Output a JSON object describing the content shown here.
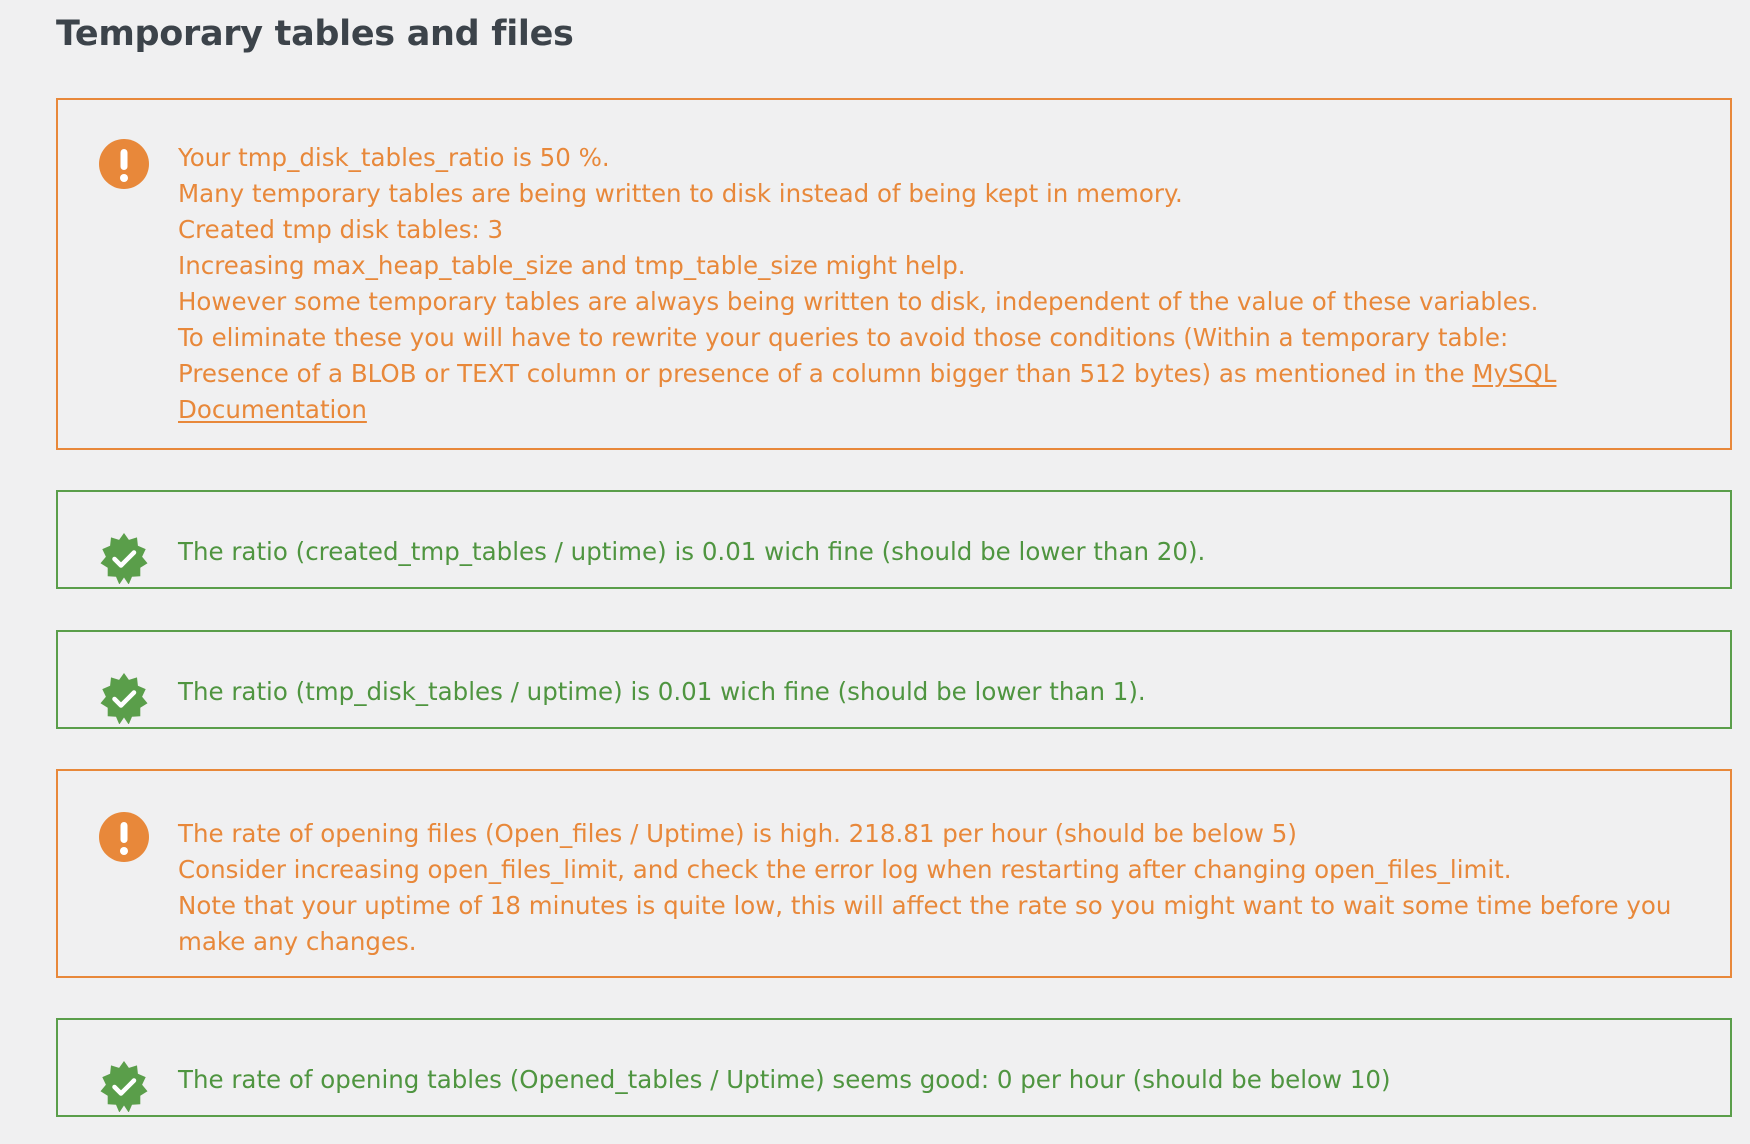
{
  "page": {
    "title": "Temporary tables and files"
  },
  "colors": {
    "warning": "#e8883a",
    "success": "#5a9e4a",
    "background": "#f0f0f1",
    "heading": "#3c434a"
  },
  "notices": [
    {
      "status": "warning",
      "icon": "exclamation-circle-icon",
      "lines": [
        "Your tmp_disk_tables_ratio is 50 %.",
        "Many temporary tables are being written to disk instead of being kept in memory.",
        "Created tmp disk tables: 3",
        "Increasing max_heap_table_size and tmp_table_size might help.",
        "However some temporary tables are always being written to disk, independent of the value of these variables.",
        "To eliminate these you will have to rewrite your queries to avoid those conditions (Within a temporary table:",
        "Presence of a BLOB or TEXT column or presence of a column bigger than 512 bytes) as mentioned in the "
      ],
      "link_part1": "MySQL",
      "link_part2": "Documentation"
    },
    {
      "status": "success",
      "icon": "check-badge-icon",
      "lines": [
        "The ratio (created_tmp_tables / uptime) is 0.01 wich fine (should be lower than 20)."
      ]
    },
    {
      "status": "success",
      "icon": "check-badge-icon",
      "lines": [
        "The ratio (tmp_disk_tables / uptime) is 0.01 wich fine (should be lower than 1)."
      ]
    },
    {
      "status": "warning",
      "icon": "exclamation-circle-icon",
      "lines": [
        "The rate of opening files (Open_files / Uptime) is high. 218.81 per hour (should be below 5)",
        "Consider increasing open_files_limit, and check the error log when restarting after changing open_files_limit.",
        "Note that your uptime of 18 minutes is quite low, this will affect the rate so you might want to wait some time before you",
        "make any changes."
      ]
    },
    {
      "status": "success",
      "icon": "check-badge-icon",
      "lines": [
        "The rate of opening tables (Opened_tables / Uptime) seems good: 0 per hour (should be below 10)"
      ]
    }
  ]
}
